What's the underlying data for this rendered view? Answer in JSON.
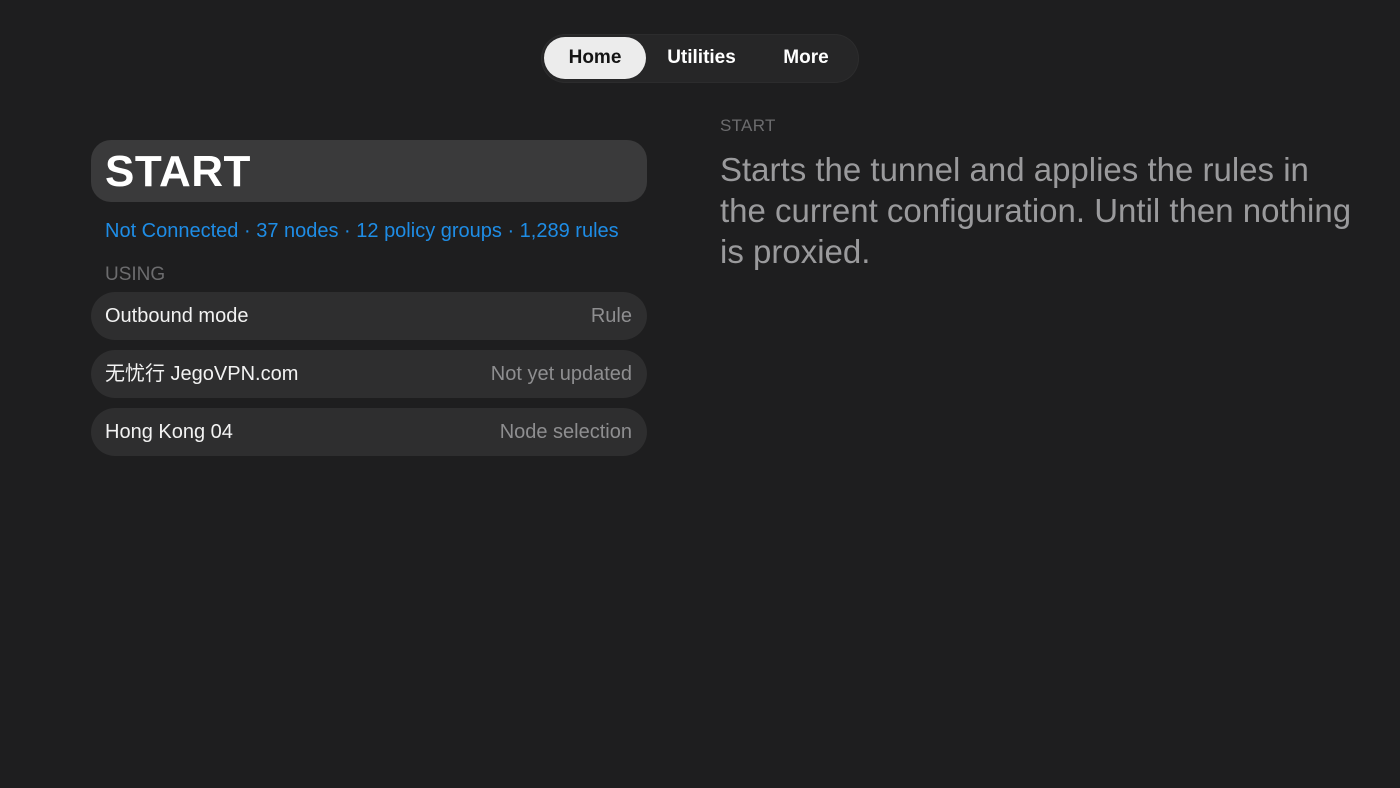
{
  "tabs": {
    "home": "Home",
    "utilities": "Utilities",
    "more": "More",
    "selected": "Home"
  },
  "main": {
    "start_label": "START",
    "status_line": "Not Connected · 37 nodes · 12 policy groups · 1,289 rules",
    "using_header": "USING",
    "rows": [
      {
        "label": "Outbound mode",
        "value": "Rule"
      },
      {
        "label": "无忧行 JegoVPN.com",
        "value": "Not yet updated"
      },
      {
        "label": "Hong Kong 04",
        "value": "Node selection"
      }
    ]
  },
  "detail": {
    "header": "START",
    "description": "Starts the tunnel and applies the rules in the current configuration. Until then nothing is proxied."
  },
  "colors": {
    "background": "#1e1e1f",
    "accent": "#1e8de6",
    "selected_tab": "#ececec"
  }
}
